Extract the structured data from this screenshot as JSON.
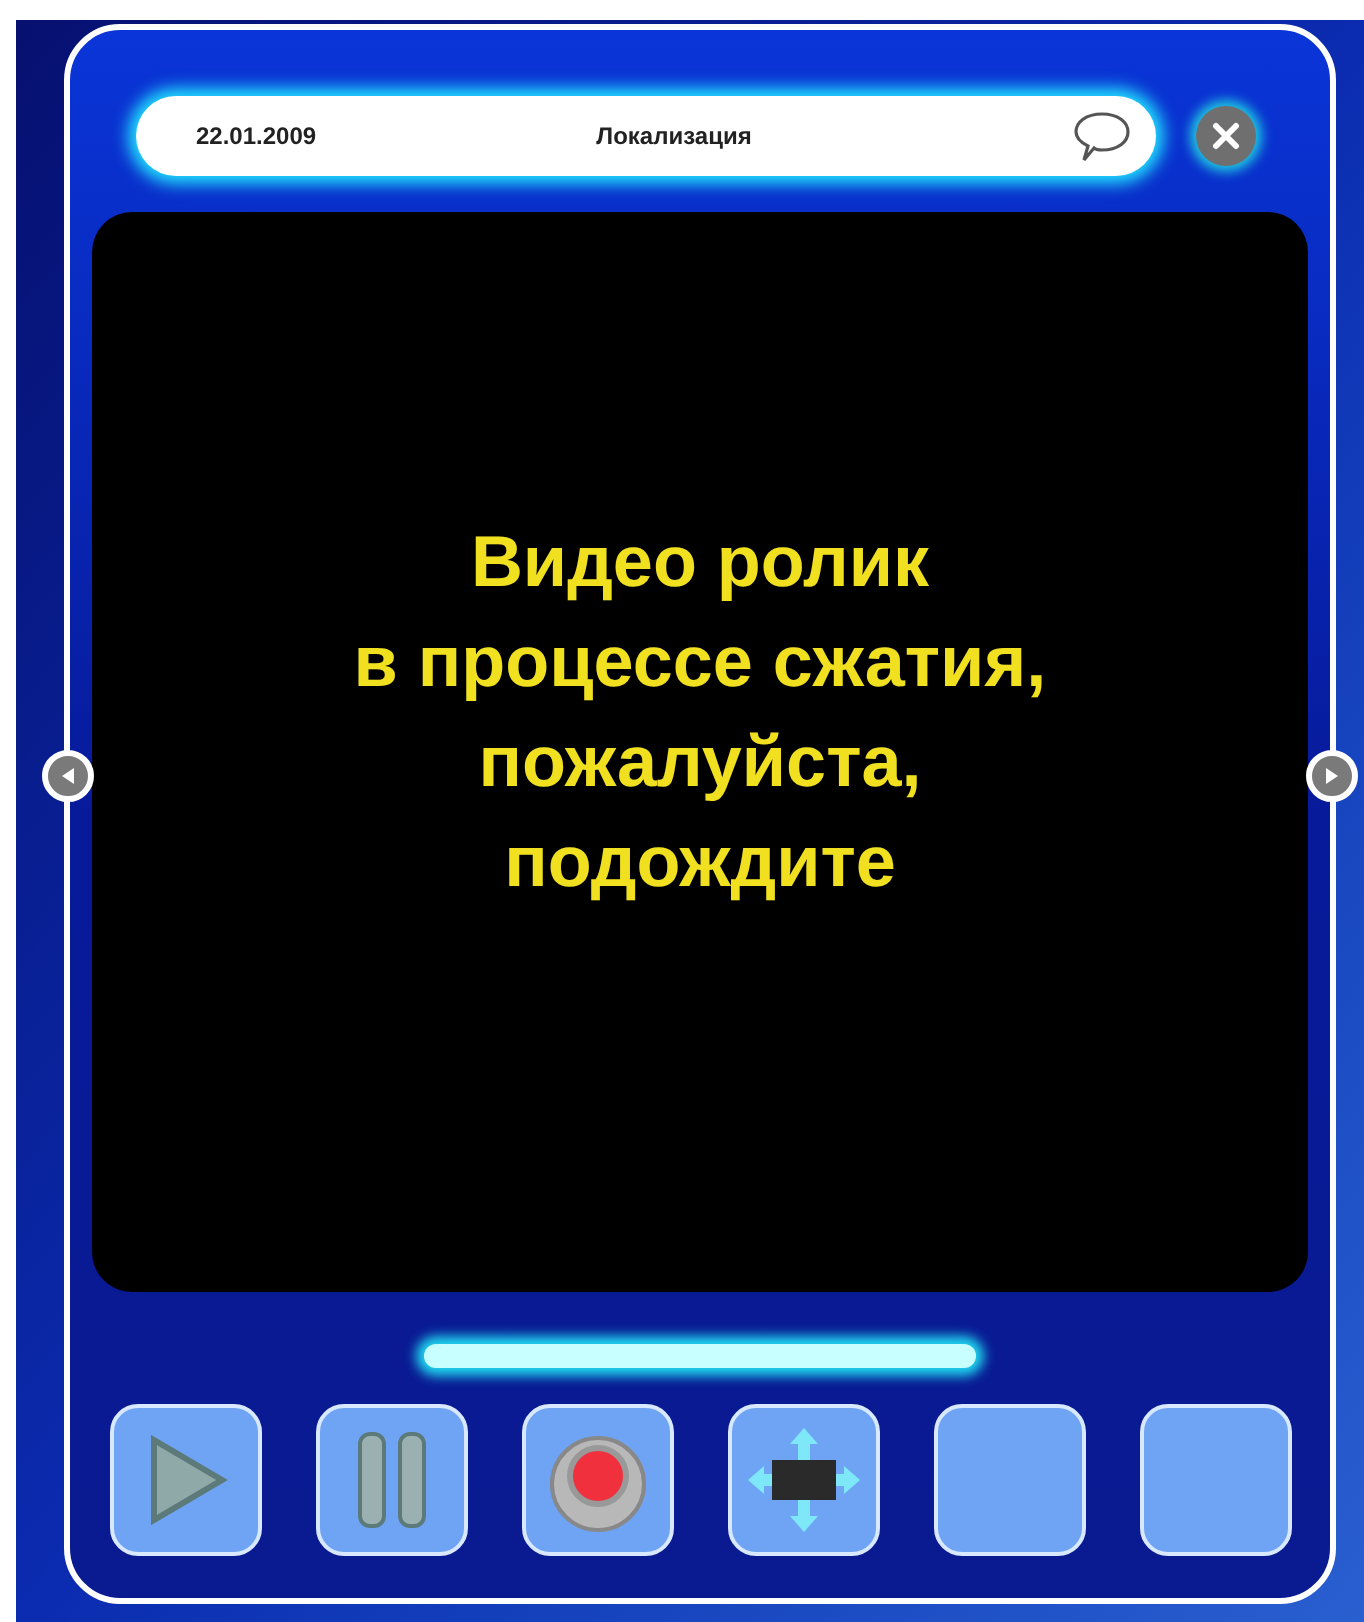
{
  "header": {
    "date": "22.01.2009",
    "title": "Локализация"
  },
  "video": {
    "message": "Видео ролик\nв процессе сжатия,\nпожалуйста,\nподождите"
  },
  "controls": [
    {
      "kind": "play"
    },
    {
      "kind": "pause"
    },
    {
      "kind": "record"
    },
    {
      "kind": "resize"
    },
    {
      "kind": "empty"
    },
    {
      "kind": "empty"
    }
  ]
}
